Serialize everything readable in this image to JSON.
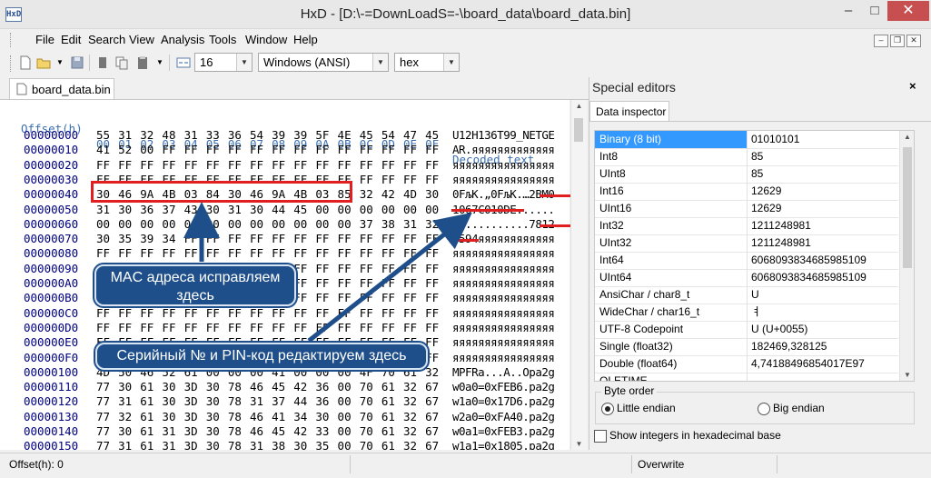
{
  "window": {
    "title": "HxD - [D:\\-=DownLoadS=-\\board_data\\board_data.bin]",
    "app_icon": "HxD"
  },
  "menu": [
    "File",
    "Edit",
    "Search",
    "View",
    "Analysis",
    "Tools",
    "Window",
    "Help"
  ],
  "toolbar": {
    "bytes_per_row": "16",
    "charset": "Windows (ANSI)",
    "base": "hex"
  },
  "document_tab": "board_data.bin",
  "hex": {
    "header": {
      "offset": "Offset(h)",
      "columns": [
        "00",
        "01",
        "02",
        "03",
        "04",
        "05",
        "06",
        "07",
        "08",
        "09",
        "0A",
        "0B",
        "0C",
        "0D",
        "0E",
        "0F"
      ],
      "decoded": "Decoded text"
    },
    "rows": [
      {
        "offset": "00000000",
        "bytes": [
          "55",
          "31",
          "32",
          "48",
          "31",
          "33",
          "36",
          "54",
          "39",
          "39",
          "5F",
          "4E",
          "45",
          "54",
          "47",
          "45"
        ],
        "text": "U12H136T99_NETGE"
      },
      {
        "offset": "00000010",
        "bytes": [
          "41",
          "52",
          "00",
          "FF",
          "FF",
          "FF",
          "FF",
          "FF",
          "FF",
          "FF",
          "FF",
          "FF",
          "FF",
          "FF",
          "FF",
          "FF"
        ],
        "text": "AR.яяяяяяяяяяяяя"
      },
      {
        "offset": "00000020",
        "bytes": [
          "FF",
          "FF",
          "FF",
          "FF",
          "FF",
          "FF",
          "FF",
          "FF",
          "FF",
          "FF",
          "FF",
          "FF",
          "FF",
          "FF",
          "FF",
          "FF"
        ],
        "text": "яяяяяяяяяяяяяяяя"
      },
      {
        "offset": "00000030",
        "bytes": [
          "FF",
          "FF",
          "FF",
          "FF",
          "FF",
          "FF",
          "FF",
          "FF",
          "FF",
          "FF",
          "FF",
          "FF",
          "FF",
          "FF",
          "FF",
          "FF"
        ],
        "text": "яяяяяяяяяяяяяяяя"
      },
      {
        "offset": "00000040",
        "bytes": [
          "30",
          "46",
          "9A",
          "4B",
          "03",
          "84",
          "30",
          "46",
          "9A",
          "4B",
          "03",
          "85",
          "32",
          "42",
          "4D",
          "30"
        ],
        "text": "0FљK.„0FљK.…2BM0"
      },
      {
        "offset": "00000050",
        "bytes": [
          "31",
          "30",
          "36",
          "37",
          "43",
          "30",
          "31",
          "30",
          "44",
          "45",
          "00",
          "00",
          "00",
          "00",
          "00",
          "00"
        ],
        "text": "1067C010DE......"
      },
      {
        "offset": "00000060",
        "bytes": [
          "00",
          "00",
          "00",
          "00",
          "00",
          "00",
          "00",
          "00",
          "00",
          "00",
          "00",
          "00",
          "37",
          "38",
          "31",
          "32"
        ],
        "text": "............7812"
      },
      {
        "offset": "00000070",
        "bytes": [
          "30",
          "35",
          "39",
          "34",
          "FF",
          "FF",
          "FF",
          "FF",
          "FF",
          "FF",
          "FF",
          "FF",
          "FF",
          "FF",
          "FF",
          "FF"
        ],
        "text": "0594яяяяяяяяяяяя"
      },
      {
        "offset": "00000080",
        "bytes": [
          "FF",
          "FF",
          "FF",
          "FF",
          "FF",
          "FF",
          "FF",
          "FF",
          "FF",
          "FF",
          "FF",
          "FF",
          "FF",
          "FF",
          "FF",
          "FF"
        ],
        "text": "яяяяяяяяяяяяяяяя"
      },
      {
        "offset": "00000090",
        "bytes": [
          "FF",
          "FF",
          "FF",
          "FF",
          "FF",
          "FF",
          "FF",
          "FF",
          "FF",
          "FF",
          "FF",
          "FF",
          "FF",
          "FF",
          "FF",
          "FF"
        ],
        "text": "яяяяяяяяяяяяяяяя"
      },
      {
        "offset": "000000A0",
        "bytes": [
          "FF",
          "FF",
          "FF",
          "FF",
          "FF",
          "FF",
          "FF",
          "FF",
          "FF",
          "FF",
          "FF",
          "FF",
          "FF",
          "FF",
          "FF",
          "FF"
        ],
        "text": "яяяяяяяяяяяяяяяя"
      },
      {
        "offset": "000000B0",
        "bytes": [
          "FF",
          "FF",
          "FF",
          "FF",
          "FF",
          "FF",
          "FF",
          "FF",
          "FF",
          "FF",
          "FF",
          "FF",
          "FF",
          "FF",
          "FF",
          "FF"
        ],
        "text": "яяяяяяяяяяяяяяяя"
      },
      {
        "offset": "000000C0",
        "bytes": [
          "FF",
          "FF",
          "FF",
          "FF",
          "FF",
          "FF",
          "FF",
          "FF",
          "FF",
          "FF",
          "FF",
          "FF",
          "FF",
          "FF",
          "FF",
          "FF"
        ],
        "text": "яяяяяяяяяяяяяяяя"
      },
      {
        "offset": "000000D0",
        "bytes": [
          "FF",
          "FF",
          "FF",
          "FF",
          "FF",
          "FF",
          "FF",
          "FF",
          "FF",
          "FF",
          "FF",
          "FF",
          "FF",
          "FF",
          "FF",
          "FF"
        ],
        "text": "яяяяяяяяяяяяяяяя"
      },
      {
        "offset": "000000E0",
        "bytes": [
          "FF",
          "FF",
          "FF",
          "FF",
          "FF",
          "FF",
          "FF",
          "FF",
          "FF",
          "FF",
          "FF",
          "FF",
          "FF",
          "FF",
          "FF",
          "FF"
        ],
        "text": "яяяяяяяяяяяяяяяя"
      },
      {
        "offset": "000000F0",
        "bytes": [
          "FF",
          "FF",
          "FF",
          "FF",
          "FF",
          "FF",
          "FF",
          "FF",
          "FF",
          "FF",
          "FF",
          "FF",
          "FF",
          "FF",
          "FF",
          "FF"
        ],
        "text": "яяяяяяяяяяяяяяяя"
      },
      {
        "offset": "00000100",
        "bytes": [
          "4D",
          "50",
          "46",
          "52",
          "61",
          "00",
          "00",
          "00",
          "41",
          "00",
          "00",
          "00",
          "4F",
          "70",
          "61",
          "32"
        ],
        "text": "MPFRa...A..Opa2g"
      },
      {
        "offset": "00000110",
        "bytes": [
          "77",
          "30",
          "61",
          "30",
          "3D",
          "30",
          "78",
          "46",
          "45",
          "42",
          "36",
          "00",
          "70",
          "61",
          "32",
          "67"
        ],
        "text": "w0a0=0xFEB6.pa2g"
      },
      {
        "offset": "00000120",
        "bytes": [
          "77",
          "31",
          "61",
          "30",
          "3D",
          "30",
          "78",
          "31",
          "37",
          "44",
          "36",
          "00",
          "70",
          "61",
          "32",
          "67"
        ],
        "text": "w1a0=0x17D6.pa2g"
      },
      {
        "offset": "00000130",
        "bytes": [
          "77",
          "32",
          "61",
          "30",
          "3D",
          "30",
          "78",
          "46",
          "41",
          "34",
          "30",
          "00",
          "70",
          "61",
          "32",
          "67"
        ],
        "text": "w2a0=0xFA40.pa2g"
      },
      {
        "offset": "00000140",
        "bytes": [
          "77",
          "30",
          "61",
          "31",
          "3D",
          "30",
          "78",
          "46",
          "45",
          "42",
          "33",
          "00",
          "70",
          "61",
          "32",
          "67"
        ],
        "text": "w0a1=0xFEB3.pa2g"
      },
      {
        "offset": "00000150",
        "bytes": [
          "77",
          "31",
          "61",
          "31",
          "3D",
          "30",
          "78",
          "31",
          "38",
          "30",
          "35",
          "00",
          "70",
          "61",
          "32",
          "67"
        ],
        "text": "w1a1=0x1805.pa2g"
      }
    ]
  },
  "status": {
    "offset": "Offset(h): 0",
    "mode": "Overwrite"
  },
  "special_editors": {
    "title": "Special editors",
    "close": "×",
    "tab": "Data inspector",
    "rows": [
      {
        "name": "Binary (8 bit)",
        "value": "01010101"
      },
      {
        "name": "Int8",
        "value": "85"
      },
      {
        "name": "UInt8",
        "value": "85"
      },
      {
        "name": "Int16",
        "value": "12629"
      },
      {
        "name": "UInt16",
        "value": "12629"
      },
      {
        "name": "Int32",
        "value": "1211248981"
      },
      {
        "name": "UInt32",
        "value": "1211248981"
      },
      {
        "name": "Int64",
        "value": "6068093834685985109"
      },
      {
        "name": "UInt64",
        "value": "6068093834685985109"
      },
      {
        "name": "AnsiChar / char8_t",
        "value": "U"
      },
      {
        "name": "WideChar / char16_t",
        "value": "ㅕ"
      },
      {
        "name": "UTF-8 Codepoint",
        "value": "U (U+0055)"
      },
      {
        "name": "Single (float32)",
        "value": "182469,328125"
      },
      {
        "name": "Double (float64)",
        "value": "4,74188496854017E97"
      },
      {
        "name": "OLETIME",
        "value": ""
      }
    ],
    "byte_order": {
      "label": "Byte order",
      "little": "Little endian",
      "big": "Big endian",
      "selected": "little"
    },
    "hex_ints_label": "Show integers in hexadecimal base"
  },
  "annotations": {
    "mac_callout": "MAC адреса исправляем здесь",
    "serial_callout": "Серийный № и PIN-код редактируем здесь",
    "accent_color": "#e02020",
    "callout_color": "#1f4f8a"
  }
}
